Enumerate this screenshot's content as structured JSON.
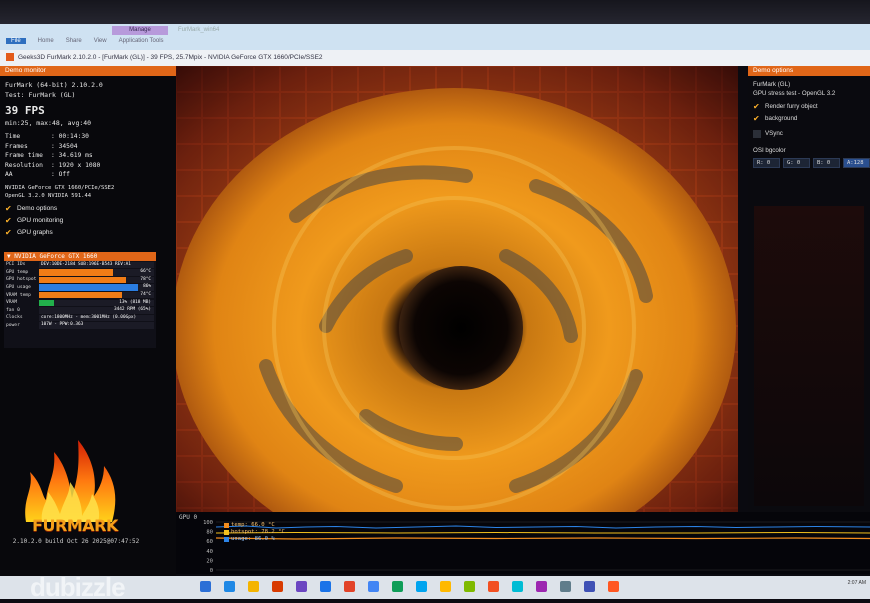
{
  "ribbon": {
    "context_tab": "Manage",
    "context_title": "FurMark_win64",
    "tabs": [
      "File",
      "Home",
      "Share",
      "View",
      "Application Tools"
    ]
  },
  "window": {
    "title": "Geeks3D FurMark 2.10.2.0 - [FurMark (GL)] - 39 FPS, 25.7Mpix - NVIDIA GeForce GTX 1660/PCIe/SSE2"
  },
  "left_panel": {
    "header": "Demo monitor",
    "app_name": "FurMark (64-bit) 2.10.2.0",
    "test": "Test: FurMark (GL)",
    "fps": "39 FPS",
    "fps_stats": "min:25, max:48, avg:40",
    "stats": [
      {
        "key": "Time",
        "value": ": 00:14:30"
      },
      {
        "key": "Frames",
        "value": ": 34504"
      },
      {
        "key": "Frame time",
        "value": ": 34.619 ms"
      },
      {
        "key": "Resolution",
        "value": ": 1920 x 1080"
      },
      {
        "key": "AA",
        "value": ": Off"
      }
    ],
    "gpu_name": "NVIDIA GeForce GTX 1660/PCIe/SSE2",
    "opengl": "OpenGL 3.2.0 NVIDIA 591.44",
    "options": [
      "Demo options",
      "GPU monitoring",
      "GPU graphs"
    ]
  },
  "gpu_monitor": {
    "title": "NVIDIA GeForce GTX 1660",
    "rows": [
      {
        "label": "PCI IDs",
        "text": "DEV:10DE-2184 SUB:196E-B543 REV:A1",
        "level": 0,
        "color": "#1b1b26"
      },
      {
        "label": "GPU temp",
        "text": "66°C",
        "level": 0.64,
        "color": "#f07c16"
      },
      {
        "label": "GPU hotspot",
        "text": "78°C",
        "level": 0.76,
        "color": "#f07c16"
      },
      {
        "label": "GPU usage",
        "text": "86%",
        "level": 0.86,
        "color": "#2a7de1"
      },
      {
        "label": "VRAM temp",
        "text": "74°C",
        "level": 0.72,
        "color": "#f07c16"
      },
      {
        "label": "VRAM",
        "text": "13% (818 MB)",
        "level": 0.13,
        "color": "#22b04b"
      },
      {
        "label": "fan 0",
        "text": "3442 RPM (65%)",
        "level": 0.65,
        "color": "#1b1b26"
      },
      {
        "label": "Clocks",
        "text": "core:1800MHz - mem:3001MHz (0.00Gpx)",
        "level": 0,
        "color": "#1b1b26"
      },
      {
        "label": "power",
        "text": "107W - PPW:0.363",
        "level": 0,
        "color": "#1b1b26"
      }
    ]
  },
  "logo": {
    "word": "FURMARK",
    "build": "2.10.2.0 build Oct 26 2025@07:47:52"
  },
  "right_panel": {
    "header": "Demo options",
    "name": "FurMark (GL)",
    "test": "GPU stress test - OpenGL 3.2",
    "checks": [
      {
        "label": "Render furry object",
        "checked": true
      },
      {
        "label": "background",
        "checked": true
      },
      {
        "label": "VSync",
        "checked": false
      }
    ],
    "osi_label": "OSI bgcolor",
    "rgba": [
      "R: 0",
      "G: 0",
      "B: 0",
      "A:128"
    ]
  },
  "graph": {
    "label": "GPU 0",
    "y_ticks": [
      "100",
      "80",
      "60",
      "40",
      "20",
      "0"
    ],
    "legend": [
      {
        "text": "temp: 66.0 °C",
        "color": "#f28c1e"
      },
      {
        "text": "hotspot: 78.2 °C",
        "color": "#f2c01e"
      },
      {
        "text": "usage: 86.0 %",
        "color": "#2c84e8"
      }
    ]
  },
  "taskbar": {
    "icons": [
      "#2b6fd6",
      "#1e88e5",
      "#f4b400",
      "#d83b01",
      "#6b46c1",
      "#1a73e8",
      "#e24329",
      "#4285f4",
      "#0f9d58",
      "#00a4ef",
      "#ffb900",
      "#7fba00",
      "#f25022",
      "#00bcd4",
      "#9c27b0",
      "#607d8b",
      "#3f51b5",
      "#ff5722"
    ],
    "clock": "2:07 AM"
  },
  "watermark": "dubizzle"
}
